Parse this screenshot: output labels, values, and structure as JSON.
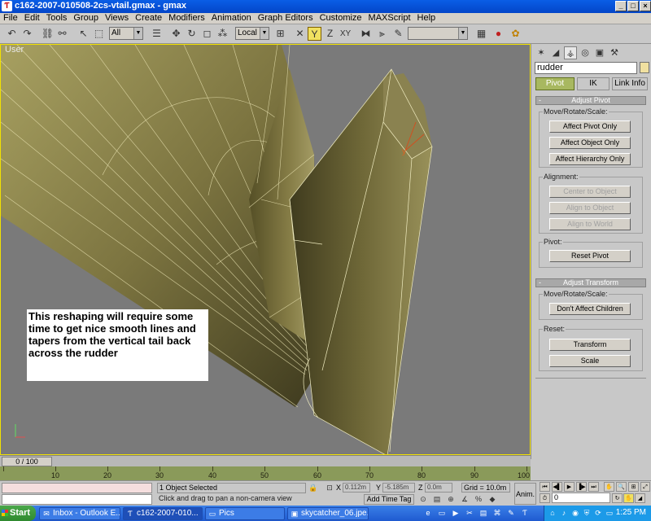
{
  "window": {
    "title": "c162-2007-010508-2cs-vtail.gmax - gmax",
    "app_icon_glyph": "Ƭ",
    "minimize_glyph": "_",
    "maximize_glyph": "□",
    "close_glyph": "×"
  },
  "menu": [
    "File",
    "Edit",
    "Tools",
    "Group",
    "Views",
    "Create",
    "Modifiers",
    "Animation",
    "Graph Editors",
    "Customize",
    "MAXScript",
    "Help"
  ],
  "toolbar": {
    "selection_filter": "All",
    "reference_coord": "Local",
    "snap_axis_y": "Y",
    "snap_axis_z": "Z",
    "snap_axis_xy": "XY",
    "named_selection": "",
    "highlight_color": "#f0e060"
  },
  "viewport": {
    "label": "User",
    "annotation": "This reshaping will require some time to get nice smooth lines and tapers from the vertical tail back across the rudder",
    "pivot_axis_label": "y",
    "model_color": "#c4bc7e"
  },
  "command_panel": {
    "object_name": "rudder",
    "object_color": "#f0e0a0",
    "subtabs": [
      "Pivot",
      "IK",
      "Link Info"
    ],
    "adjust_pivot": {
      "header": "Adjust Pivot",
      "move_group_label": "Move/Rotate/Scale:",
      "affect_pivot": "Affect Pivot Only",
      "affect_object": "Affect Object Only",
      "affect_hierarchy": "Affect Hierarchy Only",
      "alignment_label": "Alignment:",
      "center_to_object": "Center to Object",
      "align_to_object": "Align to Object",
      "align_to_world": "Align to World",
      "pivot_label": "Pivot:",
      "reset_pivot": "Reset Pivot"
    },
    "adjust_transform": {
      "header": "Adjust Transform",
      "move_group_label": "Move/Rotate/Scale:",
      "dont_affect_children": "Don't Affect Children",
      "reset_label": "Reset:",
      "transform": "Transform",
      "scale": "Scale"
    },
    "collapse_glyph": "-"
  },
  "timeline": {
    "frame_indicator": "0 / 100",
    "ticks": [
      "10",
      "20",
      "30",
      "40",
      "50",
      "60",
      "70",
      "80",
      "90",
      "100"
    ]
  },
  "status": {
    "selection": "1 Object Selected",
    "prompt": "Click and drag to pan a non-camera view",
    "x_label": "X",
    "x_value": "0.112m",
    "y_label": "Y",
    "y_value": "-5.185m",
    "z_label": "Z",
    "z_value": "0.0m",
    "grid": "Grid = 10.0m",
    "add_time_tag": "Add Time Tag",
    "anim_label": "Anim.",
    "current_frame": "0"
  },
  "taskbar": {
    "start": "Start",
    "tasks": [
      {
        "label": "Inbox - Outlook E...",
        "icon": "✉"
      },
      {
        "label": "c162-2007-010...",
        "icon": "Ƭ"
      },
      {
        "label": "Pics",
        "icon": "▭"
      },
      {
        "label": "skycatcher_06.jpe...",
        "icon": "▣"
      }
    ],
    "clock": "1:25 PM"
  }
}
